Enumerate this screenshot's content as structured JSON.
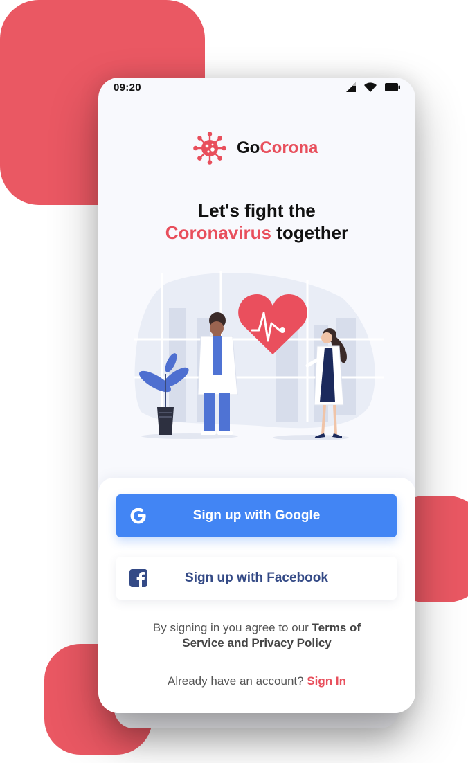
{
  "status_bar": {
    "time": "09:20"
  },
  "app": {
    "name_part1": "Go",
    "name_part2": "Corona"
  },
  "headline": {
    "line1": "Let's fight the",
    "highlight": "Coronavirus",
    "line2_rest": " together"
  },
  "buttons": {
    "google": {
      "label": "Sign up with Google",
      "icon": "google-icon"
    },
    "facebook": {
      "label": "Sign up with Facebook",
      "icon": "facebook-icon"
    }
  },
  "terms": {
    "prefix": "By signing in you agree to our ",
    "link1": "Terms of",
    "link2": "Service and Privacy Policy"
  },
  "signin": {
    "prompt": "Already have an account? ",
    "link": "Sign In"
  },
  "colors": {
    "accent": "#e84f5c",
    "google_blue": "#4285f4",
    "facebook_text": "#344a86",
    "blob": "#ea5863"
  }
}
